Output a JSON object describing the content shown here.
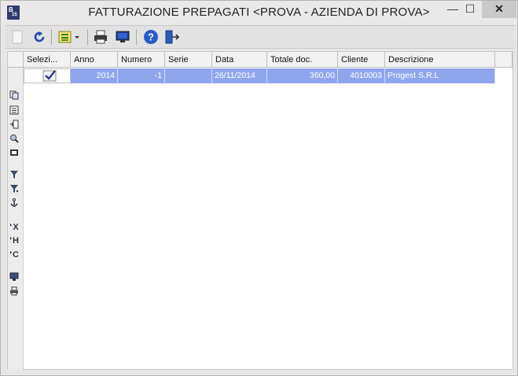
{
  "window": {
    "title": "FATTURAZIONE PREPAGATI <PROVA - AZIENDA DI PROVA>",
    "app_icon_label": "B",
    "app_icon_sub": "15",
    "minimize": "—",
    "maximize": "☐",
    "close": "✕"
  },
  "toolbar": {
    "icons": [
      "new-icon",
      "refresh-icon",
      "select-list-icon",
      "print-icon",
      "preview-monitor-icon",
      "help-icon",
      "exit-icon"
    ]
  },
  "sidebar": {
    "icons": [
      "copy-icon",
      "list-icon",
      "insert-icon",
      "search-icon",
      "detail-icon",
      "filter-icon",
      "filter-clear-icon",
      "anchor-icon",
      "export-excel-icon",
      "export-html-icon",
      "export-csv-icon",
      "screen-icon",
      "print-icon"
    ]
  },
  "grid": {
    "columns": [
      "Selezi...",
      "Anno",
      "Numero",
      "Serie",
      "Data",
      "Totale doc.",
      "Cliente",
      "Descrizione"
    ],
    "rows": [
      {
        "selected": true,
        "anno": "2014",
        "numero": "-1",
        "serie": "",
        "data": "26/11/2014",
        "totale": "360,00",
        "cliente": "4010003",
        "descrizione": "Progest S.R.L"
      }
    ]
  },
  "colors": {
    "selection": "#8fa6ee",
    "background": "#e7e7e7"
  }
}
